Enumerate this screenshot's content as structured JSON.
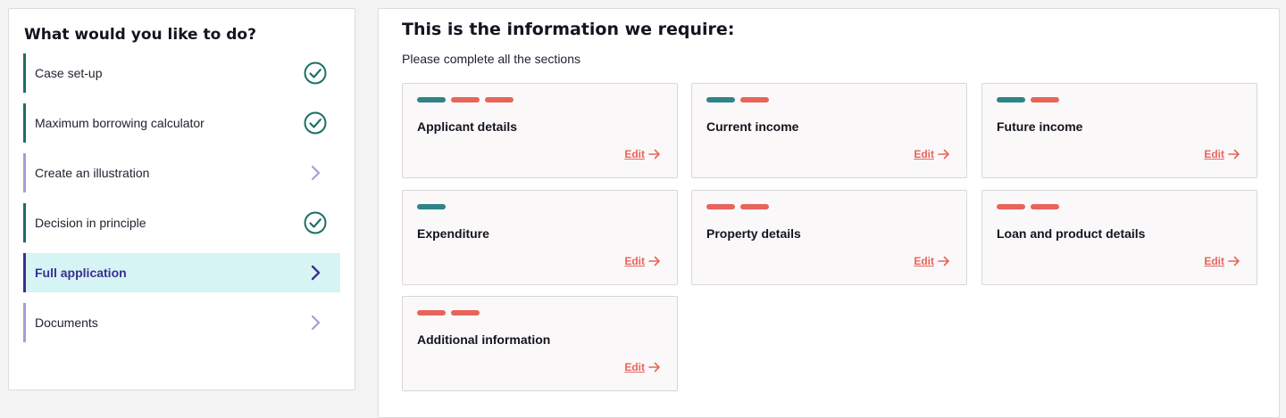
{
  "sidebar": {
    "title": "What would you like to do?",
    "items": [
      {
        "label": "Case set-up",
        "status": "complete",
        "status_icon": "check-circle-icon"
      },
      {
        "label": "Maximum borrowing calculator",
        "status": "complete",
        "status_icon": "check-circle-icon"
      },
      {
        "label": "Create an illustration",
        "status": "pending",
        "status_icon": "chevron-right-icon"
      },
      {
        "label": "Decision in principle",
        "status": "complete",
        "status_icon": "check-circle-icon"
      },
      {
        "label": "Full application",
        "status": "active",
        "status_icon": "chevron-right-icon"
      },
      {
        "label": "Documents",
        "status": "pending",
        "status_icon": "chevron-right-icon"
      }
    ]
  },
  "main": {
    "title": "This is the information we require:",
    "subtitle": "Please complete all the sections",
    "edit_label": "Edit",
    "edit_icon": "arrow-right-icon",
    "cards": [
      {
        "title": "Applicant details",
        "pills": [
          "complete",
          "incomplete",
          "incomplete"
        ]
      },
      {
        "title": "Current income",
        "pills": [
          "complete",
          "incomplete"
        ]
      },
      {
        "title": "Future income",
        "pills": [
          "complete",
          "incomplete"
        ]
      },
      {
        "title": "Expenditure",
        "pills": [
          "complete"
        ]
      },
      {
        "title": "Property details",
        "pills": [
          "incomplete",
          "incomplete"
        ]
      },
      {
        "title": "Loan and product details",
        "pills": [
          "incomplete",
          "incomplete"
        ]
      },
      {
        "title": "Additional information",
        "pills": [
          "incomplete",
          "incomplete"
        ]
      }
    ]
  },
  "colors": {
    "complete": "#2e8487",
    "incomplete": "#e8645a",
    "active_bg": "#d6f4f4",
    "active_text": "#3b2f94",
    "nav_done_border": "#1f6e64",
    "nav_pending_border": "#a39fd9"
  }
}
